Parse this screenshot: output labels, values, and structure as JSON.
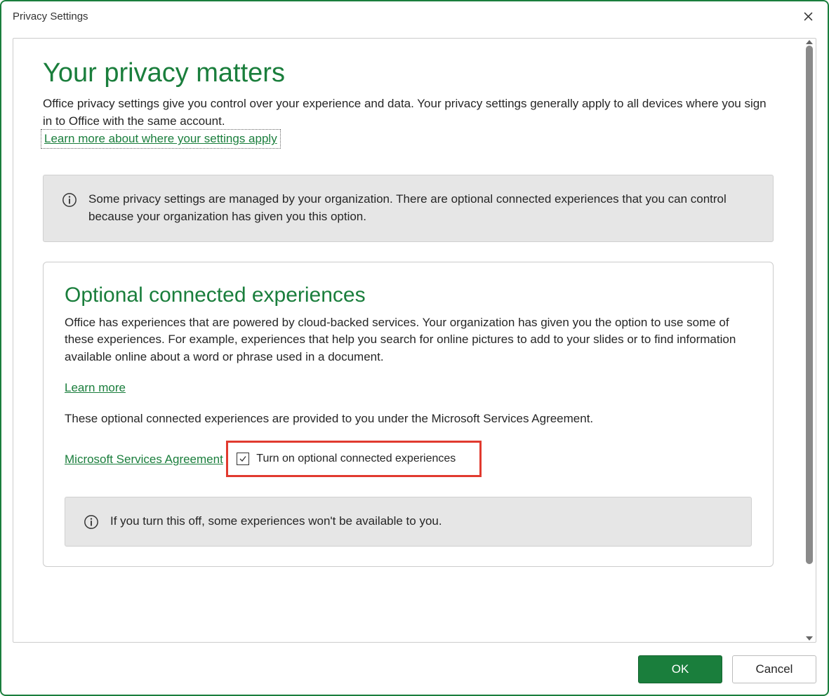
{
  "window": {
    "title": "Privacy Settings"
  },
  "main": {
    "heading": "Your privacy matters",
    "intro": "Office privacy settings give you control over your experience and data. Your privacy settings generally apply to all devices where you sign in to Office with the same account.",
    "learn_more_link": "Learn more about where your settings apply",
    "org_notice": "Some privacy settings are managed by your organization. There are optional connected experiences that you can control because your organization has given you this option."
  },
  "section": {
    "heading": "Optional connected experiences",
    "body": "Office has experiences that are powered by cloud-backed services. Your organization has given you the option to use some of these experiences. For example, experiences that help you search for online pictures to add to your slides or to find information available online about a word or phrase used in a document.",
    "learn_more": "Learn more",
    "agreement_intro": "These optional connected experiences are provided to you under the Microsoft Services Agreement.",
    "agreement_link": "Microsoft Services Agreement",
    "checkbox_label": "Turn on optional connected experiences",
    "checkbox_checked": true,
    "turn_off_notice": "If you turn this off, some experiences won't be available to you."
  },
  "footer": {
    "ok": "OK",
    "cancel": "Cancel"
  }
}
